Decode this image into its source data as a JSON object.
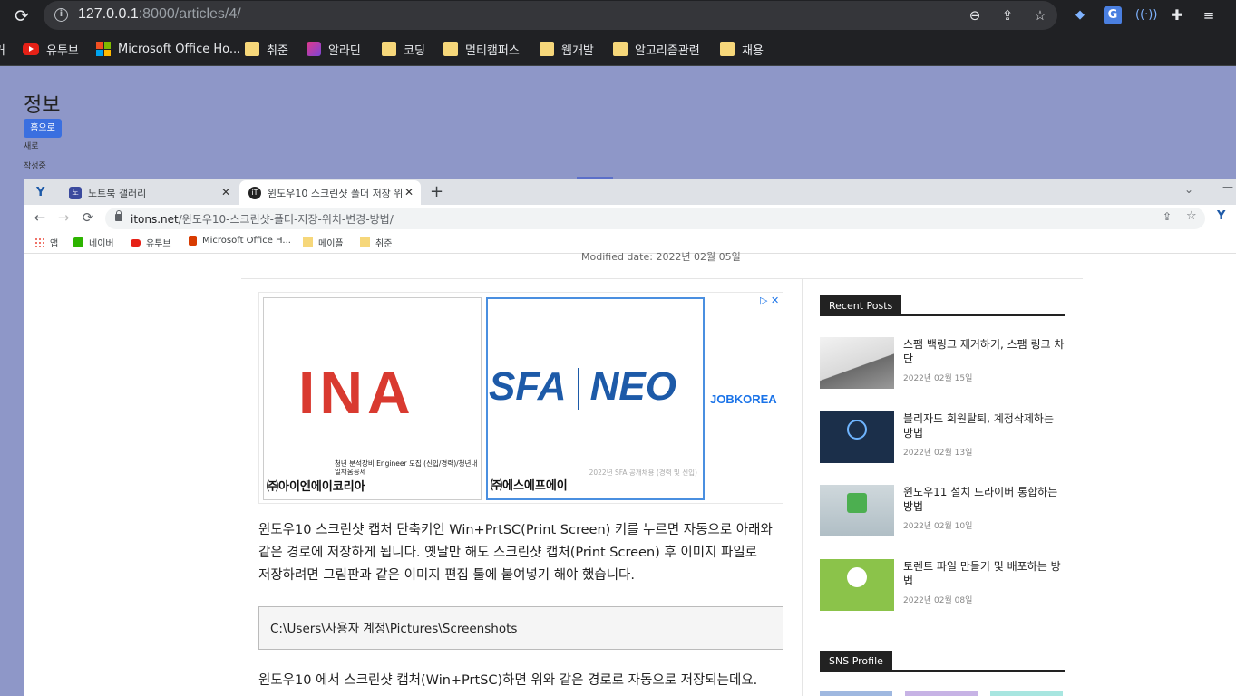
{
  "outer_browser": {
    "url_host": "127.0.0.1",
    "url_rest": ":8000/articles/4/",
    "bookmarks": [
      {
        "label": "유투브",
        "icon": "youtube-icon"
      },
      {
        "label": "Microsoft Office Ho...",
        "icon": "microsoft-office-icon"
      },
      {
        "label": "취준",
        "icon": "folder-icon"
      },
      {
        "label": "알라딘",
        "icon": "aladin-icon"
      },
      {
        "label": "코딩",
        "icon": "folder-icon"
      },
      {
        "label": "멀티캠퍼스",
        "icon": "folder-icon"
      },
      {
        "label": "웹개발",
        "icon": "folder-icon"
      },
      {
        "label": "알고리즘관련",
        "icon": "folder-icon"
      },
      {
        "label": "채용",
        "icon": "folder-icon"
      }
    ],
    "bookmark_cut": "커"
  },
  "page": {
    "title": "정보",
    "home_button": "홈으로",
    "line1": "새로",
    "line2": "작성중"
  },
  "inner_browser": {
    "tabs": [
      {
        "label": "노트북 갤러리"
      },
      {
        "label": "윈도우10 스크린샷 폴더 저장 위"
      }
    ],
    "url_host": "itons.net",
    "url_rest": "/윈도우10-스크린샷-폴더-저장-위치-변경-방법/",
    "bookmarks": [
      {
        "label": "앱",
        "icon": "apps-grid-icon"
      },
      {
        "label": "네이버",
        "icon": "naver-icon"
      },
      {
        "label": "유투브",
        "icon": "youtube-icon"
      },
      {
        "label": "Microsoft Office H...",
        "icon": "office-icon"
      },
      {
        "label": "메이플",
        "icon": "folder-icon"
      },
      {
        "label": "취준",
        "icon": "folder-icon"
      }
    ]
  },
  "article": {
    "modified": "Modified date: 2022년 02월 05일",
    "ad": {
      "card1_logo": "INA",
      "card1_desc": "청년 분석장비 Engineer 모집 (신입/경력)/청년내일채움공제",
      "card1_company": "㈜아이엔에이코리아",
      "card2_logo_left": "SFA",
      "card2_logo_right": "NEO",
      "card2_desc": "2022년 SFA 공개채용 (경력 및 신입)",
      "card2_company": "㈜에스에프에이",
      "card3_logo": "JOBKOREA"
    },
    "para1_l1": "윈도우10 스크린샷 캡처 단축키인 Win+PrtSC(Print Screen) 키를 누르면 자동으로 아래와",
    "para1_l2": "같은 경로에 저장하게 됩니다. 옛날만 해도 스크린샷 캡처(Print Screen) 후 이미지 파일로",
    "para1_l3": "저장하려면 그림판과 같은 이미지 편집 툴에 붙여넣기 해야 했습니다.",
    "code": "C:\\Users\\사용자 계정\\Pictures\\Screenshots",
    "para2": "윈도우10 에서 스크린샷 캡처(Win+PrtSC)하면 위와 같은 경로로 자동으로 저장되는데요."
  },
  "sidebar": {
    "recent_title": "Recent Posts",
    "posts": [
      {
        "title": "스팸 백링크 제거하기, 스팸 링크 차단",
        "date": "2022년 02월 15일"
      },
      {
        "title": "블리자드 회원탈퇴, 계정삭제하는 방법",
        "date": "2022년 02월 13일"
      },
      {
        "title": "윈도우11 설치 드라이버 통합하는 방법",
        "date": "2022년 02월 10일"
      },
      {
        "title": "토렌트 파일 만들기 및 배포하는 방법",
        "date": "2022년 02월 08일"
      }
    ],
    "sns_title": "SNS Profile"
  },
  "colors": {
    "page_bg": "#8e97c8",
    "home_button": "#3a6fe0",
    "chrome_dark": "#202124"
  }
}
